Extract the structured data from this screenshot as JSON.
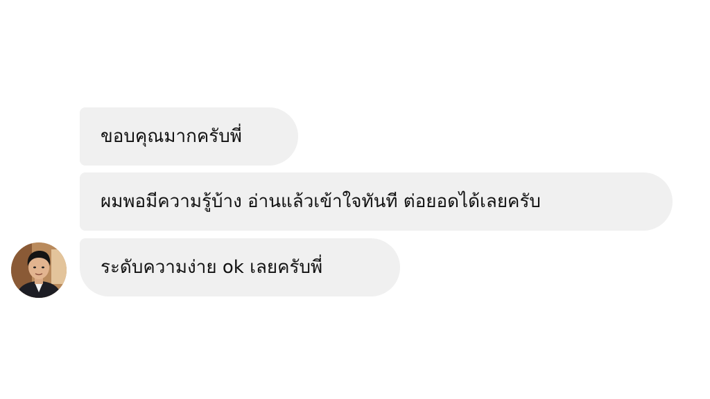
{
  "messages": [
    {
      "text": "ขอบคุณมากครับพี่"
    },
    {
      "text": "ผมพอมีความรู้บ้าง อ่านแล้วเข้าใจทันที ต่อยอดได้เลยครับ"
    },
    {
      "text": "ระดับความง่าย ok เลยครับพี่"
    }
  ],
  "colors": {
    "bubble_background": "#f0f0f0",
    "text": "#111111",
    "page_background": "#ffffff"
  },
  "icons": {
    "sender_avatar": "user-avatar-photo"
  }
}
